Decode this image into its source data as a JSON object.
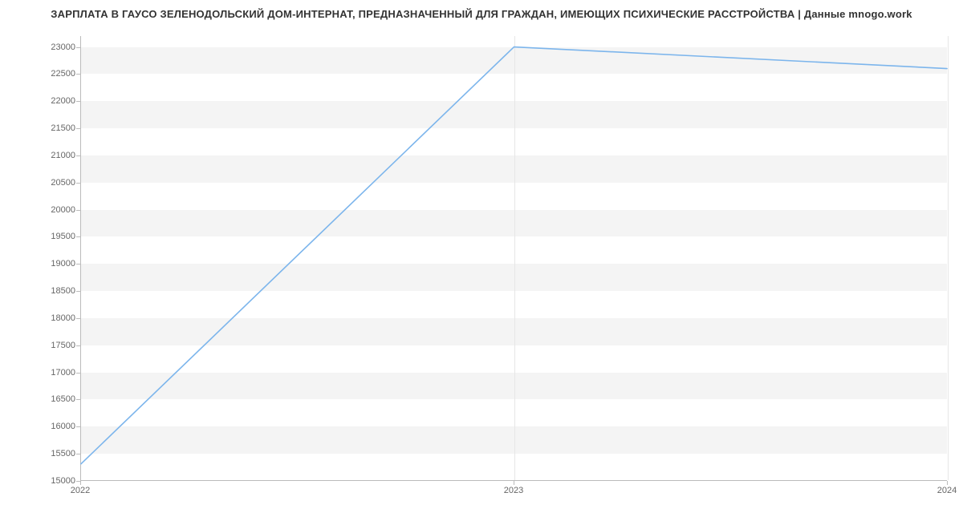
{
  "chart_data": {
    "type": "line",
    "title": "ЗАРПЛАТА В ГАУСО ЗЕЛЕНОДОЛЬСКИЙ ДОМ-ИНТЕРНАТ, ПРЕДНАЗНАЧЕННЫЙ ДЛЯ ГРАЖДАН, ИМЕЮЩИХ ПСИХИЧЕСКИЕ РАССТРОЙСТВА | Данные mnogo.work",
    "xlabel": "",
    "ylabel": "",
    "x": [
      2022,
      2023,
      2024
    ],
    "values": [
      15300,
      23000,
      22600
    ],
    "x_ticks": [
      2022,
      2023,
      2024
    ],
    "y_ticks": [
      15000,
      15500,
      16000,
      16500,
      17000,
      17500,
      18000,
      18500,
      19000,
      19500,
      20000,
      20500,
      21000,
      21500,
      22000,
      22500,
      23000
    ],
    "ylim": [
      15000,
      23200
    ],
    "xlim": [
      2022,
      2024
    ],
    "line_color": "#7cb5ec",
    "band_color": "#f4f4f4"
  }
}
